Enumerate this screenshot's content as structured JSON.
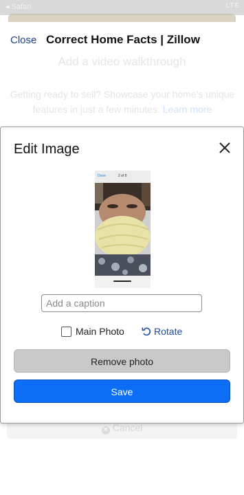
{
  "status_bar": {
    "back_app": "◂ Safari",
    "network": "LTE"
  },
  "header": {
    "close_label": "Close",
    "title": "Correct Home Facts | Zillow"
  },
  "background_page": {
    "heading": "Add a video walkthrough",
    "body_text": "Getting ready to sell? Showcase your home's unique features in just a few minutes.",
    "link_text": "Learn more",
    "cancel_label": "Cancel"
  },
  "modal": {
    "title": "Edit Image",
    "close_icon": "close-icon",
    "photo_topbar_left": "Done",
    "photo_topbar_center": "2 of 8",
    "caption_placeholder": "Add a caption",
    "caption_value": "",
    "main_photo_label": "Main Photo",
    "main_photo_checked": false,
    "rotate_label": "Rotate",
    "rotate_icon": "rotate-left-icon",
    "remove_label": "Remove photo",
    "save_label": "Save"
  },
  "colors": {
    "link": "#1b3f86",
    "rotate": "#1a4da3",
    "save_button": "#0b6ef4",
    "remove_button": "#c9c9c9"
  }
}
